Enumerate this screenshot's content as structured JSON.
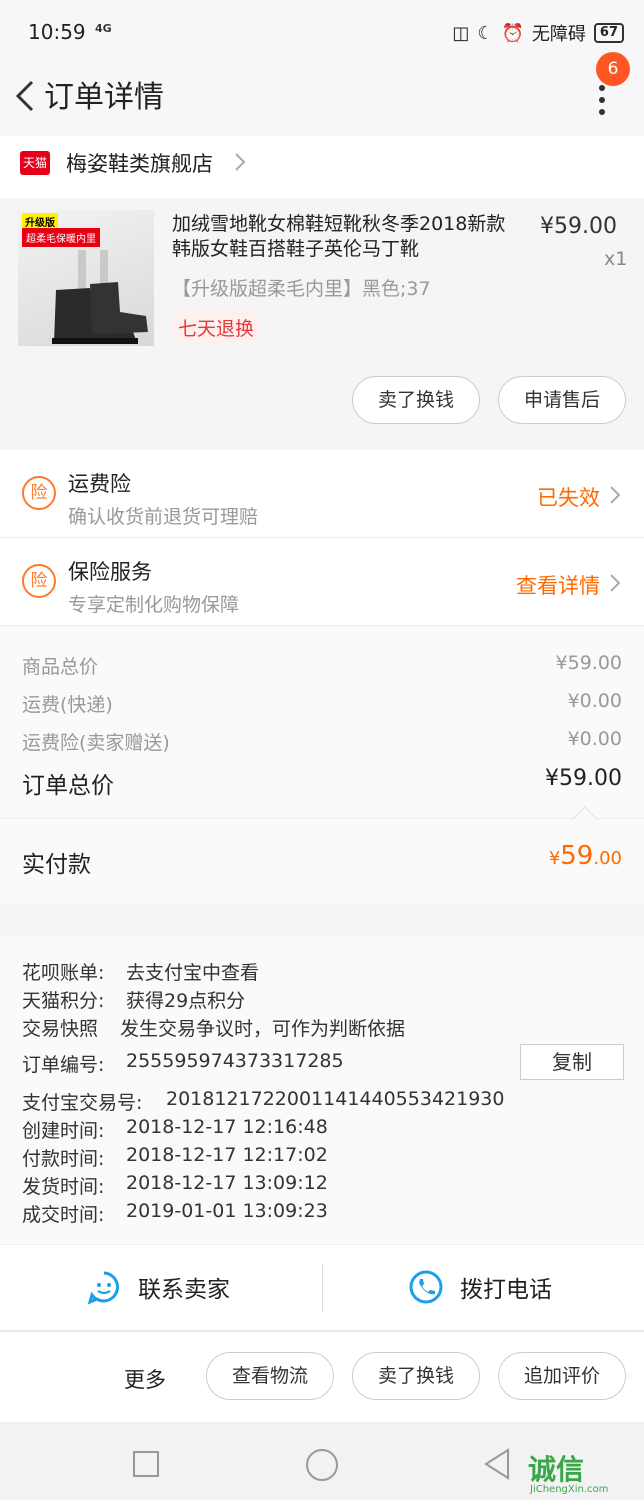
{
  "status_bar": {
    "time": "10:59",
    "network": "4G",
    "accessibility": "无障碍",
    "battery": "67"
  },
  "header": {
    "title": "订单详情",
    "badge": "6"
  },
  "store": {
    "logo_text": "天猫",
    "name": "梅姿鞋类旗舰店"
  },
  "product": {
    "image_tag_1": "升级版",
    "image_tag_2": "超柔毛保暖内里",
    "title": "加绒雪地靴女棉鞋短靴秋冬季2018新款韩版女鞋百搭鞋子英伦马丁靴",
    "price": "¥59.00",
    "qty": "x1",
    "spec": "【升级版超柔毛内里】黑色;37",
    "return_tag": "七天退换",
    "buttons": [
      "卖了换钱",
      "申请售后"
    ]
  },
  "insurance": [
    {
      "icon": "险",
      "title": "运费险",
      "subtitle": "确认收货前退货可理赔",
      "status": "已失效"
    },
    {
      "icon": "险",
      "title": "保险服务",
      "subtitle": "专享定制化购物保障",
      "status": "查看详情"
    }
  ],
  "price_summary": {
    "rows": [
      {
        "label": "商品总价",
        "value": "¥59.00"
      },
      {
        "label": "运费(快递)",
        "value": "¥0.00"
      },
      {
        "label": "运费险(卖家赠送)",
        "value": "¥0.00"
      }
    ],
    "total_label": "订单总价",
    "total_value": "¥59.00",
    "paid_label": "实付款",
    "paid_currency": "¥",
    "paid_int": "59",
    "paid_dec": ".00"
  },
  "info": {
    "huabei_label": "花呗账单:",
    "huabei_value": "去支付宝中查看",
    "points_label": "天猫积分:",
    "points_value": "获得29点积分",
    "snapshot_label": "交易快照",
    "snapshot_value": "发生交易争议时，可作为判断依据",
    "order_no_label": "订单编号:",
    "order_no": "2555959743733172​85",
    "copy_label": "复制",
    "alipay_label": "支付宝交易号:",
    "alipay_no": "2018121722001141440553421930",
    "created_label": "创建时间:",
    "created": "2018-12-17 12:16:48",
    "paid_label": "付款时间:",
    "paid": "2018-12-17 12:17:02",
    "shipped_label": "发货时间:",
    "shipped": "2018-12-17 13:09:12",
    "completed_label": "成交时间:",
    "completed": "2019-01-01 13:09:23"
  },
  "contact": {
    "seller": "联系卖家",
    "phone": "拨打电话"
  },
  "actions": {
    "more": "更多",
    "buttons": [
      "查看物流",
      "卖了换钱",
      "追加评价"
    ]
  },
  "watermark": {
    "text": "诚信",
    "sub": "JiChengXin.com"
  },
  "colors": {
    "accent": "#ff6a00",
    "tmall": "#e4001b",
    "badge": "#ff5722"
  }
}
